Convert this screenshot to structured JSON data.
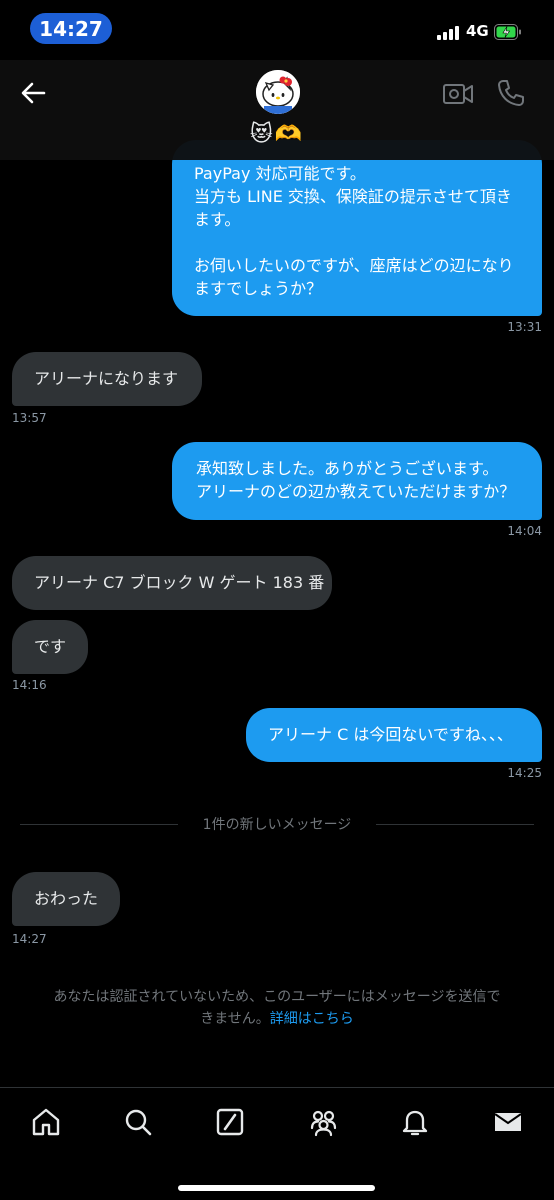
{
  "status_bar": {
    "time": "14:27",
    "network": "4G"
  },
  "header": {
    "display_name": "😻🫶",
    "icons": [
      "back-arrow-icon",
      "avatar",
      "video-call-icon",
      "phone-icon"
    ]
  },
  "messages": [
    {
      "direction": "out",
      "text": "PayPay 対応可能です。\n当方も LINE 交換、保険証の提示させて頂き\nます。\n\nお伺いしたいのですが、座席はどの辺になり\nますでしょうか？",
      "time": "13:31"
    },
    {
      "direction": "in",
      "text": "アリーナになります",
      "time": "13:57"
    },
    {
      "direction": "out",
      "text": "承知致しました。ありがとうございます。\nアリーナのどの辺か教えていただけますか？",
      "time": "14:04"
    },
    {
      "direction": "in",
      "text": "アリーナ C7 ブロック W ゲート 183 番",
      "time": ""
    },
    {
      "direction": "in",
      "text": "です",
      "time": "14:16"
    },
    {
      "direction": "out",
      "text": "アリーナ C は今回ないですね、、、",
      "time": "14:25"
    },
    {
      "direction": "in",
      "text": "おわった",
      "time": "14:27"
    }
  ],
  "new_messages_divider": "1件の新しいメッセージ",
  "notice": {
    "text": "あなたは認証されていないため、このユーザーにはメッセージを送信で\nきません。",
    "link": "詳細はこちら"
  },
  "bottom_nav": {
    "items": [
      "home-icon",
      "search-icon",
      "grok-icon",
      "communities-icon",
      "notifications-icon",
      "messages-icon"
    ]
  },
  "colors": {
    "accent": "#1d9bf0",
    "incoming_bubble": "#2f3336",
    "background": "#000000",
    "time_pill": "#1d5fd6"
  }
}
